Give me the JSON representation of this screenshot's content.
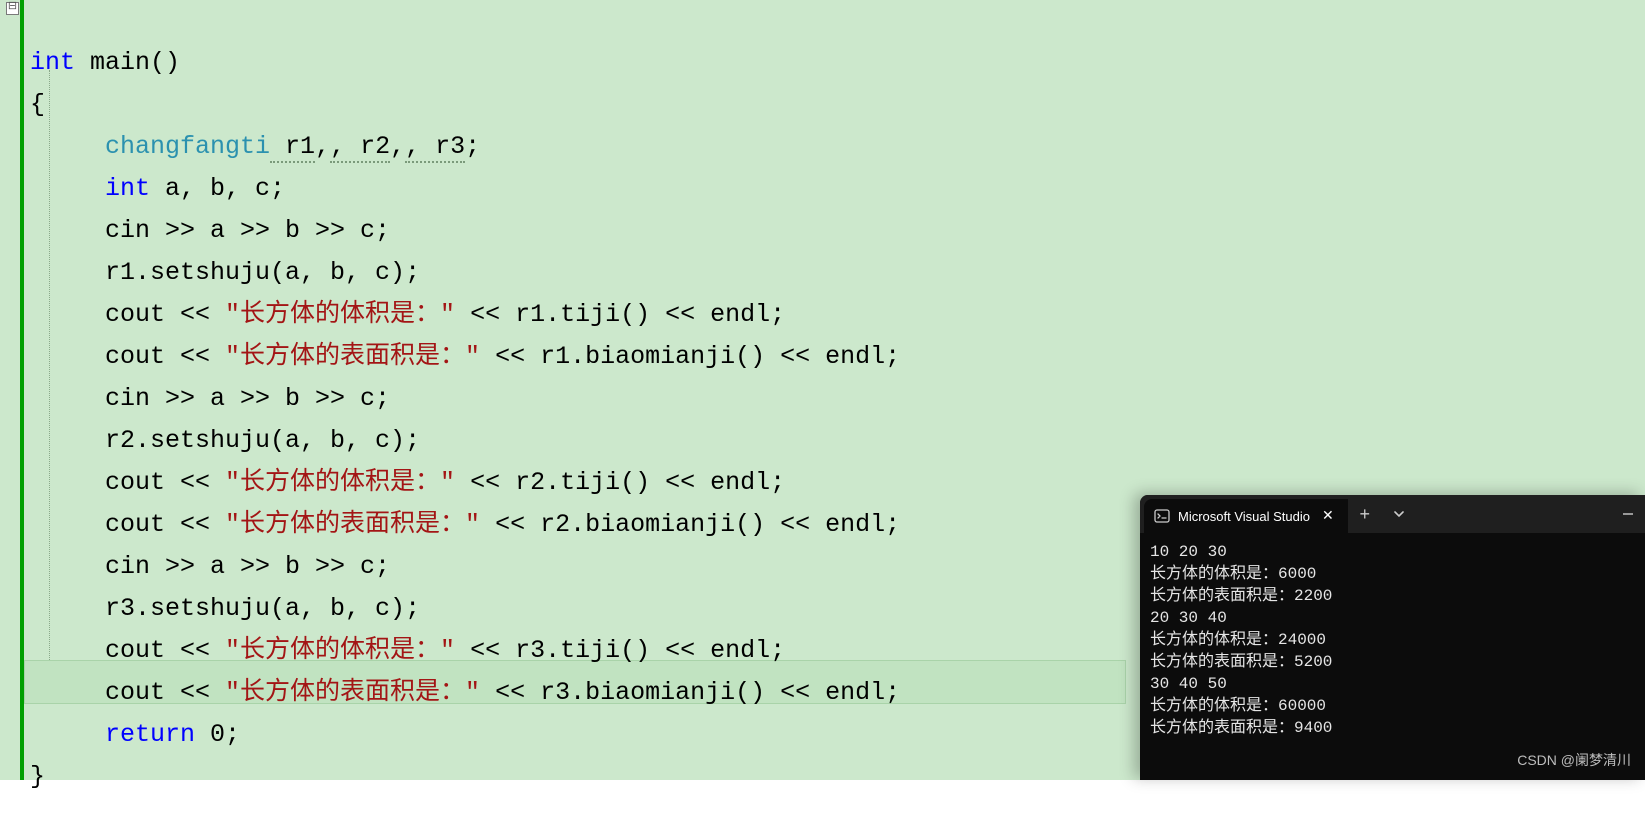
{
  "fold_glyph": "⊟",
  "code": {
    "l1": {
      "kw_int": "int",
      "main": " main()"
    },
    "l2": "{",
    "l3": {
      "type": "changfangti",
      "vars": [
        " r1",
        ", r2",
        ", r3"
      ],
      "semi": ";"
    },
    "l4": {
      "kw_int": "int",
      "rest": " a, b, c;"
    },
    "l5": "cin >> a >> b >> c;",
    "l6": "r1.setshuju(a, b, c);",
    "l7": {
      "pre": "cout << ",
      "str": "\"长方体的体积是：\"",
      "post": " << r1.tiji() << endl;"
    },
    "l8": {
      "pre": "cout << ",
      "str": "\"长方体的表面积是：\"",
      "post": " << r1.biaomianji() << endl;"
    },
    "l9": "cin >> a >> b >> c;",
    "l10": "r2.setshuju(a, b, c);",
    "l11": {
      "pre": "cout << ",
      "str": "\"长方体的体积是：\"",
      "post": " << r2.tiji() << endl;"
    },
    "l12": {
      "pre": "cout << ",
      "str": "\"长方体的表面积是：\"",
      "post": " << r2.biaomianji() << endl;"
    },
    "l13": "cin >> a >> b >> c;",
    "l14": "r3.setshuju(a, b, c);",
    "l15": {
      "pre": "cout << ",
      "str": "\"长方体的体积是：\"",
      "post": " << r3.tiji() << endl;"
    },
    "l16": {
      "pre": "cout << ",
      "str": "\"长方体的表面积是：\"",
      "post": " << r3.biaomianji() << endl;"
    },
    "l17": {
      "kw_return": "return",
      "rest": " 0;"
    },
    "l18": "}"
  },
  "terminal": {
    "tab_title": "Microsoft Visual Studio",
    "output": [
      "10 20 30",
      "长方体的体积是：6000",
      "长方体的表面积是：2200",
      "20 30 40",
      "长方体的体积是：24000",
      "长方体的表面积是：5200",
      "30 40 50",
      "长方体的体积是：60000",
      "长方体的表面积是：9400"
    ]
  },
  "watermark": "CSDN @阑梦清川"
}
